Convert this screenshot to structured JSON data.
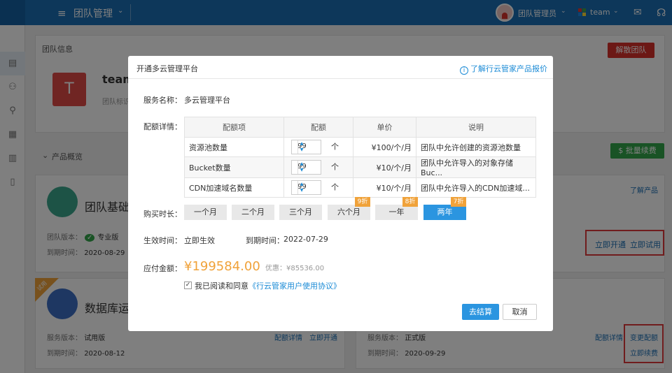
{
  "topbar": {
    "title": "团队管理",
    "user_name": "团队管理员",
    "team_name": "team",
    "brand_color": "#1b6fb5"
  },
  "page": {
    "team_info_title": "团队信息",
    "dissolve_button": "解散团队",
    "team_avatar_letter": "T",
    "team_name": "team",
    "team_sub": "团队标识",
    "products_title": "产品概览",
    "batch_renew_button": "批量续费",
    "learn_more": "了解产品",
    "product1": {
      "title": "团队基础",
      "version_label": "团队版本：",
      "version_value": "专业版",
      "expiry_label": "到期时间：",
      "expiry_value": "2020-08-29",
      "open_now": "立即开通",
      "try_now": "立即试用"
    },
    "product2": {
      "badge": "试用",
      "title": "数据库运",
      "version_label": "服务版本：",
      "version_value": "试用版",
      "expiry_label": "到期时间：",
      "expiry_value": "2020-08-12",
      "quota_details": "配额详情",
      "open_now": "立即开通"
    },
    "product3": {
      "version_label": "服务版本：",
      "version_value": "正式版",
      "expiry_label": "到期时间：",
      "expiry_value": "2020-09-29",
      "quota_details": "配额详情",
      "change_quota": "变更配额",
      "renew_now": "立即续费"
    }
  },
  "modal": {
    "title": "开通多云管理平台",
    "price_info_link": "了解行云管家产品报价",
    "service_name_label": "服务名称：",
    "service_name_value": "多云管理平台",
    "quota_label": "配额详情：",
    "table_headers": [
      "配额项",
      "配额",
      "单价",
      "说明"
    ],
    "table_rows": [
      {
        "item": "资源池数量",
        "quota": "99",
        "unit": "个",
        "price": "¥100/个/月",
        "desc": "团队中允许创建的资源池数量"
      },
      {
        "item": "Bucket数量",
        "quota": "99",
        "unit": "个",
        "price": "¥10/个/月",
        "desc": "团队中允许导入的对象存储Buc..."
      },
      {
        "item": "CDN加速域名数量",
        "quota": "99",
        "unit": "个",
        "price": "¥10/个/月",
        "desc": "团队中允许导入的CDN加速域..."
      }
    ],
    "duration_label": "购买时长：",
    "durations": [
      "一个月",
      "二个月",
      "三个月",
      "六个月",
      "一年",
      "两年"
    ],
    "selected_duration": "两年",
    "discounts": [
      "9折",
      "8折",
      "7折"
    ],
    "effective_label": "生效时间：",
    "effective_value": "立即生效",
    "expiry_label": "到期时间：",
    "expiry_value": "2022-07-29",
    "amount_label": "应付金额：",
    "amount_value": "¥199584.00",
    "savings": "优惠：¥85536.00",
    "agree_prefix": "我已阅读和同意",
    "agree_link": "《行云管家用户使用协议》",
    "checkout_button": "去结算",
    "cancel_button": "取消"
  }
}
